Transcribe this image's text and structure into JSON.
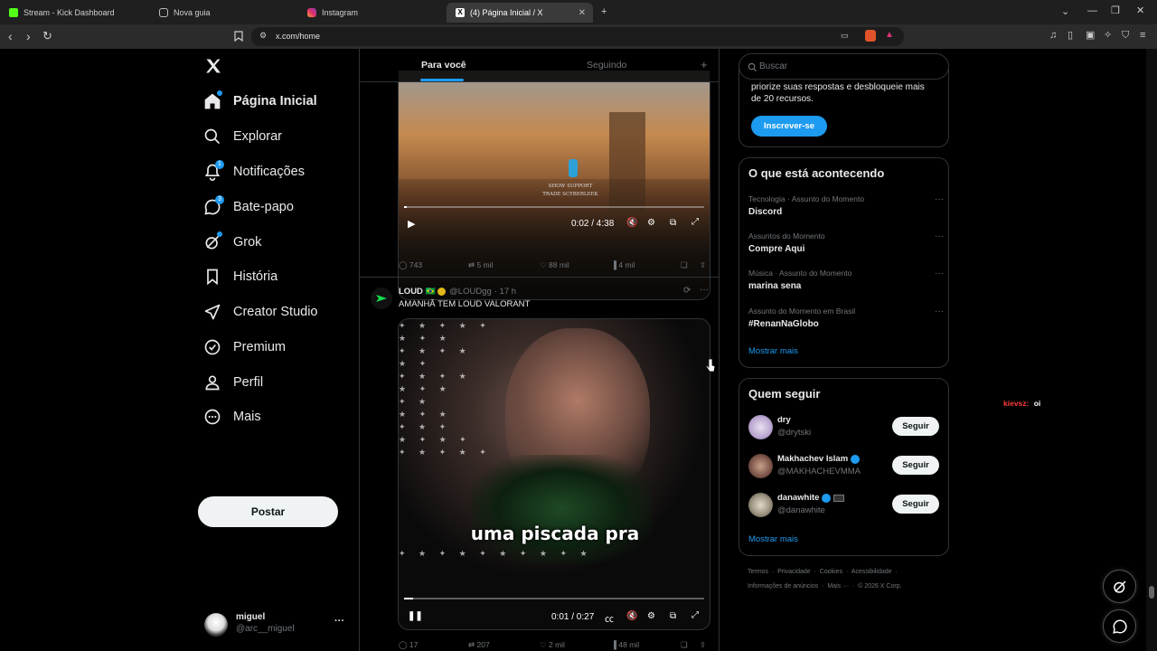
{
  "browser": {
    "tabs": [
      {
        "label": "Stream - Kick Dashboard"
      },
      {
        "label": "Nova guia"
      },
      {
        "label": "Instagram"
      },
      {
        "label": "(4) Página Inicial / X"
      }
    ],
    "new_tab": "+",
    "url": "x.com/home"
  },
  "sidebar": {
    "items": [
      {
        "label": "Página Inicial",
        "icon": "home-icon"
      },
      {
        "label": "Explorar",
        "icon": "search-icon"
      },
      {
        "label": "Notificações",
        "icon": "bell-icon",
        "badge": "1"
      },
      {
        "label": "Bate-papo",
        "icon": "chat-icon",
        "badge": "3"
      },
      {
        "label": "Grok",
        "icon": "grok-icon"
      },
      {
        "label": "História",
        "icon": "bookmark-icon"
      },
      {
        "label": "Creator Studio",
        "icon": "rocket-icon"
      },
      {
        "label": "Premium",
        "icon": "verified-icon"
      },
      {
        "label": "Perfil",
        "icon": "person-icon"
      },
      {
        "label": "Mais",
        "icon": "more-circle-icon"
      }
    ],
    "post_label": "Postar",
    "account": {
      "name": "miguel",
      "handle": "@arc__miguel",
      "more": "···"
    }
  },
  "feed": {
    "tabs": [
      {
        "label": "Para você"
      },
      {
        "label": "Seguindo"
      }
    ],
    "add_tab": "+",
    "post1": {
      "video_time": "0:02 / 4:38",
      "video_progress": 0.01,
      "overlay_text": [
        "SHOW SUPPORT",
        "TRADE SCYBERLEEK"
      ],
      "replies": "743",
      "reposts": "5 mil",
      "likes": "88 mil",
      "views": "4 mil"
    },
    "post2": {
      "author": "LOUD",
      "flag": "🇧🇷",
      "handle": "@LOUDgg",
      "time": "· 17 h",
      "text": "AMANHÃ TEM LOUD VALORANT",
      "caption": "uma piscada pra",
      "video_time": "0:01 / 0:27",
      "video_progress": 0.03,
      "replies": "17",
      "reposts": "207",
      "likes": "2 mil",
      "views": "48 mil"
    }
  },
  "right": {
    "search_placeholder": "Buscar",
    "premium_text": "priorize suas respostas e desbloqueie mais de 20 recursos.",
    "subscribe_label": "Inscrever-se",
    "trends_title": "O que está acontecendo",
    "trends": [
      {
        "meta": "Tecnologia · Assunto do Momento",
        "name": "Discord"
      },
      {
        "meta": "Assuntos do Momento",
        "name": "Compre Aqui"
      },
      {
        "meta": "Música · Assunto do Momento",
        "name": "marina sena"
      },
      {
        "meta": "Assunto do Momento em Brasil",
        "name": "#RenanNaGlobo"
      }
    ],
    "trend_more": "···",
    "show_more": "Mostrar mais",
    "who_title": "Quem seguir",
    "who": [
      {
        "name": "dry",
        "handle": "@drytski",
        "verified": false
      },
      {
        "name": "Makhachev Islam",
        "handle": "@MAKHACHEVMMA",
        "verified": true
      },
      {
        "name": "danawhite",
        "handle": "@danawhite",
        "verified": true
      }
    ],
    "follow_label": "Seguir",
    "who_more": "Mostrar mais",
    "footer": [
      "Termos",
      "Privacidade",
      "Cookies",
      "Acessibilidade",
      "Informações de anúncios",
      "Mais ···",
      "© 2026 X Corp."
    ]
  },
  "overlay_chat": {
    "user": "kievsz:",
    "message": "oi"
  },
  "colors": {
    "accent": "#1d9bf0",
    "background": "#000000",
    "text": "#e7e9ea",
    "muted": "#71767b",
    "border": "#2f3336"
  }
}
